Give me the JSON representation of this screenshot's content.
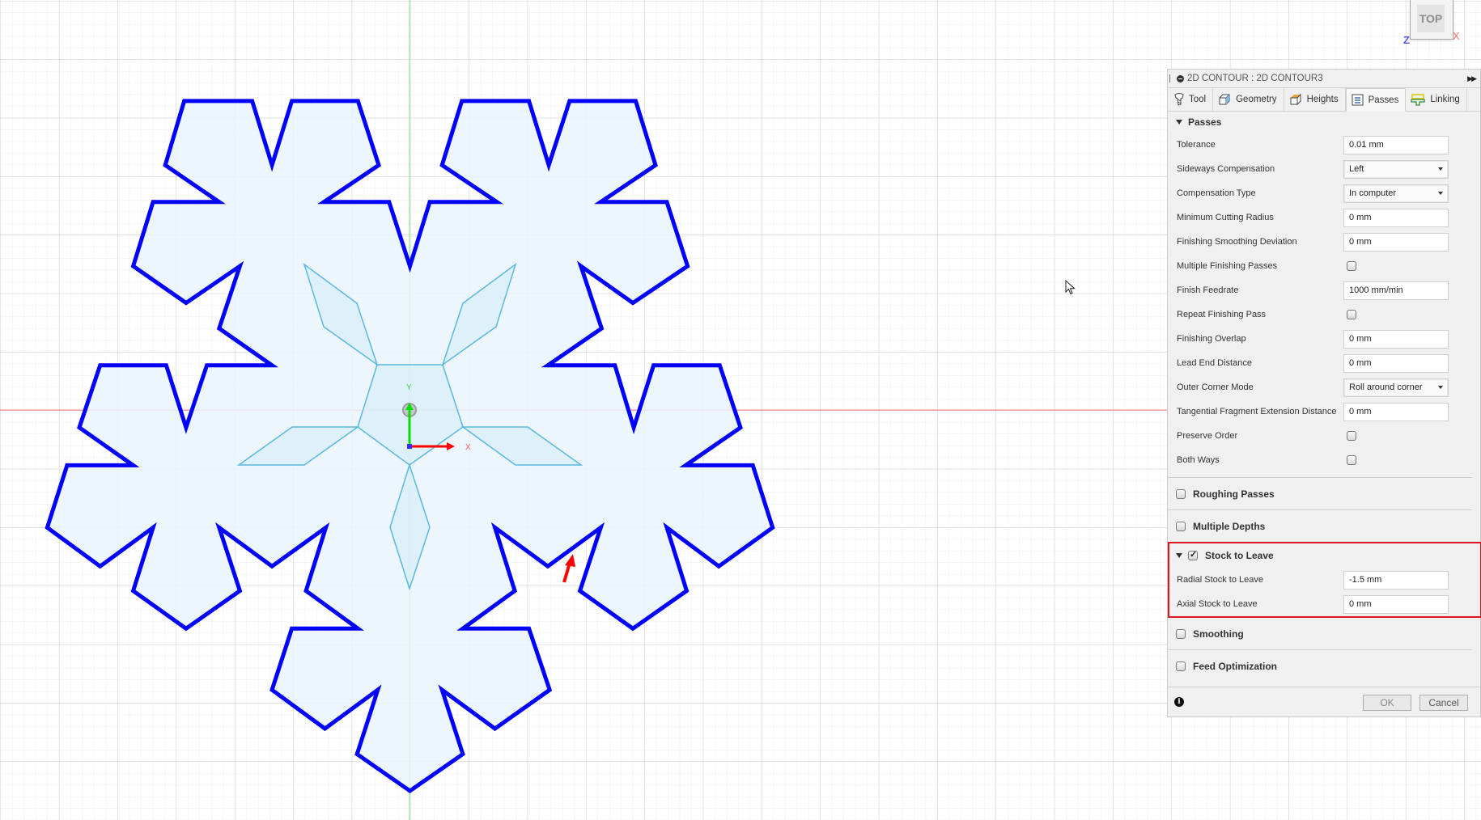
{
  "viewport": {
    "view_cube": {
      "face_label": "TOP",
      "z_label": "Z",
      "x_label": "X"
    },
    "origin_axes": {
      "x_label": "X",
      "y_label": "Y"
    },
    "colors": {
      "contour_stroke": "#0000ff",
      "sketch_stroke": "#5bb8e0",
      "fill": "#e9f5fc",
      "x_axis": "#ff0000",
      "y_axis": "#00d000",
      "annotation_arrow": "#ff0000",
      "highlight_box": "#e0141e"
    }
  },
  "panel": {
    "title": "2D CONTOUR : 2D CONTOUR3",
    "tabs": [
      {
        "label": "Tool",
        "icon": "tool-icon",
        "active": false
      },
      {
        "label": "Geometry",
        "icon": "geometry-icon",
        "active": false
      },
      {
        "label": "Heights",
        "icon": "heights-icon",
        "active": false
      },
      {
        "label": "Passes",
        "icon": "passes-icon",
        "active": true
      },
      {
        "label": "Linking",
        "icon": "linking-icon",
        "active": false
      }
    ],
    "passes": {
      "section_label": "Passes",
      "tolerance": {
        "label": "Tolerance",
        "value": "0.01 mm"
      },
      "sideways_compensation": {
        "label": "Sideways Compensation",
        "value": "Left"
      },
      "compensation_type": {
        "label": "Compensation Type",
        "value": "In computer"
      },
      "min_cutting_radius": {
        "label": "Minimum Cutting Radius",
        "value": "0 mm"
      },
      "finishing_smoothing_deviation": {
        "label": "Finishing Smoothing Deviation",
        "value": "0 mm"
      },
      "multiple_finishing_passes": {
        "label": "Multiple Finishing Passes",
        "checked": false
      },
      "finish_feedrate": {
        "label": "Finish Feedrate",
        "value": "1000 mm/min"
      },
      "repeat_finishing_pass": {
        "label": "Repeat Finishing Pass",
        "checked": false
      },
      "finishing_overlap": {
        "label": "Finishing Overlap",
        "value": "0 mm"
      },
      "lead_end_distance": {
        "label": "Lead End Distance",
        "value": "0 mm"
      },
      "outer_corner_mode": {
        "label": "Outer Corner Mode",
        "value": "Roll around corner"
      },
      "tangential_fragment_extension": {
        "label": "Tangential Fragment Extension Distance",
        "value": "0 mm"
      },
      "preserve_order": {
        "label": "Preserve Order",
        "checked": false
      },
      "both_ways": {
        "label": "Both Ways",
        "checked": false
      }
    },
    "roughing_passes": {
      "label": "Roughing Passes",
      "checked": false
    },
    "multiple_depths": {
      "label": "Multiple Depths",
      "checked": false
    },
    "stock_to_leave": {
      "label": "Stock to Leave",
      "checked": true,
      "radial": {
        "label": "Radial Stock to Leave",
        "value": "-1.5 mm"
      },
      "axial": {
        "label": "Axial Stock to Leave",
        "value": "0 mm"
      }
    },
    "smoothing": {
      "label": "Smoothing",
      "checked": false
    },
    "feed_optimization": {
      "label": "Feed Optimization",
      "checked": false
    },
    "footer": {
      "ok_label": "OK",
      "cancel_label": "Cancel",
      "info_glyph": "i"
    }
  }
}
